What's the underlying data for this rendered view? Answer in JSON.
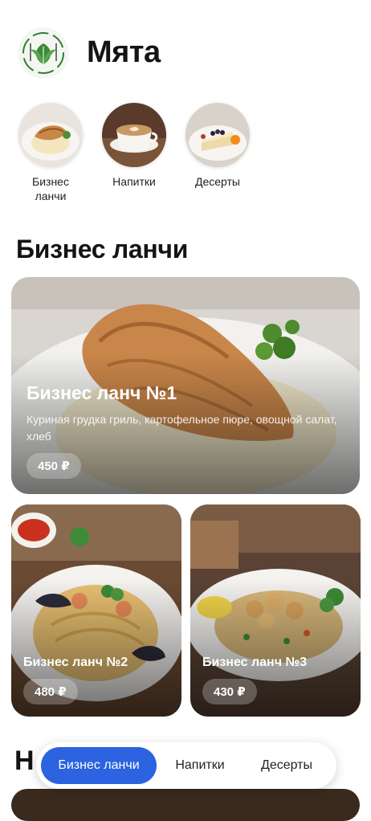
{
  "app": {
    "title": "Мята"
  },
  "categories": [
    {
      "label": "Бизнес ланчи"
    },
    {
      "label": "Напитки"
    },
    {
      "label": "Десерты"
    }
  ],
  "section": {
    "title": "Бизнес ланчи"
  },
  "next_section": {
    "title_partial": "Н"
  },
  "cards": [
    {
      "title": "Бизнес ланч №1",
      "description": "Куриная грудка гриль, картофельное пюре, овощной салат, хлеб",
      "price": "450 ₽"
    },
    {
      "title": "Бизнес ланч №2",
      "price": "480 ₽"
    },
    {
      "title": "Бизнес ланч №3",
      "price": "430 ₽"
    }
  ],
  "bottom_nav": {
    "tabs": [
      {
        "label": "Бизнес ланчи",
        "active": true
      },
      {
        "label": "Напитки",
        "active": false
      },
      {
        "label": "Десерты",
        "active": false
      }
    ]
  },
  "colors": {
    "accent": "#2b63e0",
    "brand_green": "#3d8b37"
  }
}
